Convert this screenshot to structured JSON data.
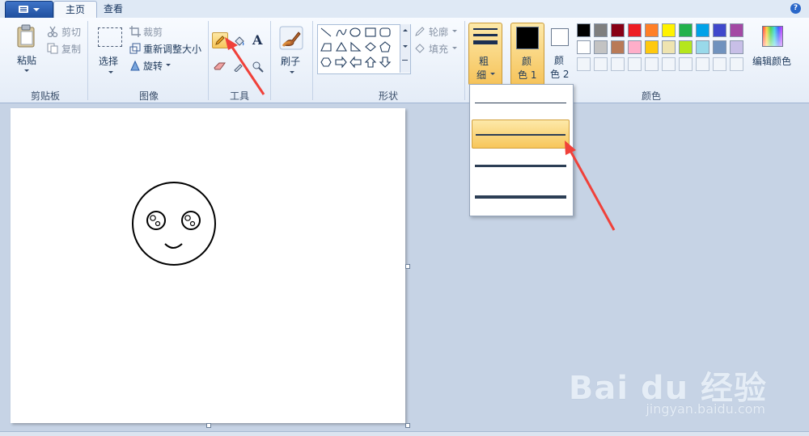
{
  "tabs": {
    "home": "主页",
    "view": "查看"
  },
  "help_icon": "?",
  "clipboard": {
    "paste": "粘贴",
    "cut": "剪切",
    "copy": "复制",
    "group_label": "剪贴板"
  },
  "image": {
    "select": "选择",
    "crop": "裁剪",
    "resize": "重新调整大小",
    "rotate": "旋转",
    "group_label": "图像"
  },
  "tools": {
    "group_label": "工具",
    "text_glyph": "A"
  },
  "brushes": {
    "label": "刷子"
  },
  "shapes": {
    "outline": "轮廓",
    "fill": "填充",
    "group_label": "形状"
  },
  "size": {
    "label_line1": "粗",
    "label_line2": "细"
  },
  "color1": {
    "label_line1": "颜",
    "label_line2": "色 1",
    "value": "#000000"
  },
  "color2": {
    "label_line1": "颜",
    "label_line2": "色 2",
    "value": "#ffffff"
  },
  "colors": {
    "group_label": "颜色",
    "edit": "编辑颜色",
    "palette_row1": [
      "#000000",
      "#7f7f7f",
      "#880015",
      "#ed1c24",
      "#ff7f27",
      "#fff200",
      "#22b14c",
      "#00a2e8",
      "#3f48cc",
      "#a349a4"
    ],
    "palette_row2": [
      "#ffffff",
      "#c3c3c3",
      "#b97a57",
      "#ffaec9",
      "#ffc90e",
      "#efe4b0",
      "#b5e61d",
      "#99d9ea",
      "#7092be",
      "#c8bfe7"
    ]
  },
  "size_options": {
    "selected_index": 1,
    "count": 4
  },
  "watermark": {
    "brand": "Bai du 经验",
    "url": "jingyan.baidu.com"
  }
}
